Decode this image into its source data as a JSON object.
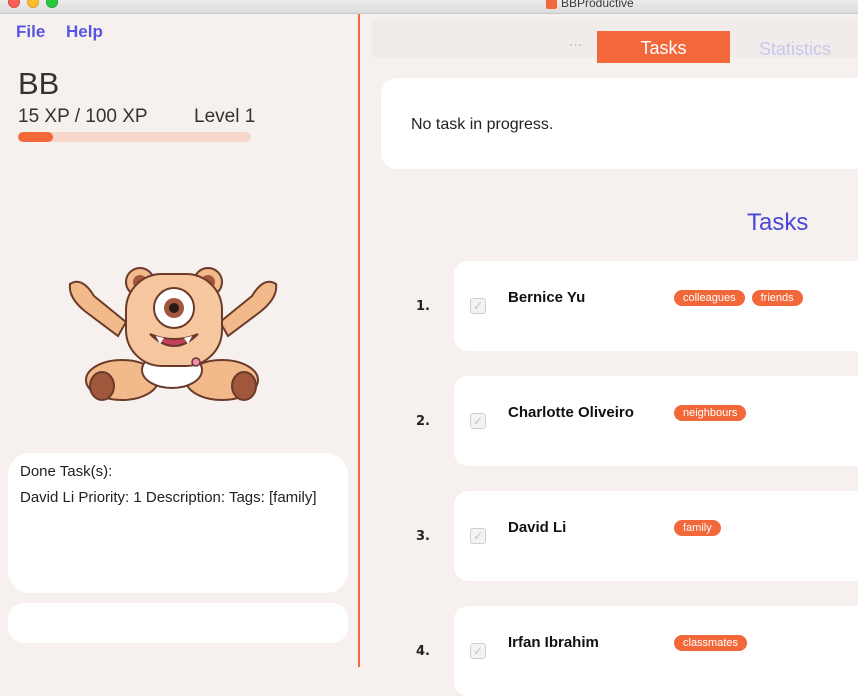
{
  "window": {
    "title": "BBProductive"
  },
  "menu": {
    "file": "File",
    "help": "Help"
  },
  "profile": {
    "name": "BB",
    "xp_text": "15 XP / 100 XP",
    "level_text": "Level 1",
    "xp_progress": 0.15
  },
  "done_panel": {
    "title": "Done Task(s):",
    "line": "David Li Priority: 1 Description:  Tags: [family]"
  },
  "tabs": {
    "overflow": "...",
    "active": "Tasks",
    "statistics": "Statistics"
  },
  "in_progress": {
    "text": "No task in progress."
  },
  "tasks_heading": "Tasks",
  "tasks": [
    {
      "index": "1.",
      "name": "Bernice Yu",
      "tags": [
        "colleagues",
        "friends"
      ]
    },
    {
      "index": "2.",
      "name": "Charlotte Oliveiro",
      "tags": [
        "neighbours"
      ]
    },
    {
      "index": "3.",
      "name": "David Li",
      "tags": [
        "family"
      ]
    },
    {
      "index": "4.",
      "name": "Irfan Ibrahim",
      "tags": [
        "classmates"
      ]
    }
  ],
  "colors": {
    "accent": "#f2683b",
    "heading": "#4b48d9",
    "menu": "#5a55e0"
  }
}
